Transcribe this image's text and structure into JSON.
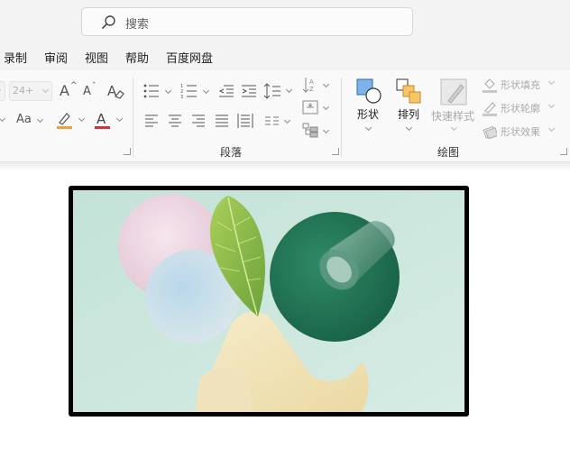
{
  "search": {
    "placeholder": "搜索"
  },
  "menu": {
    "items": [
      "录制",
      "审阅",
      "视图",
      "帮助",
      "百度网盘"
    ]
  },
  "font": {
    "size_value": "24+",
    "grow_glyph": "A",
    "shrink_glyph": "A",
    "case_label": "Aa"
  },
  "groups": {
    "paragraph": "段落",
    "drawing": "绘图"
  },
  "drawing": {
    "shapes_label": "形状",
    "arrange_label": "排列",
    "quick_styles_label": "快速样式",
    "shape_fill_label": "形状填充",
    "shape_outline_label": "形状轮廓",
    "shape_effects_label": "形状效果"
  },
  "colors": {
    "accent_blue": "#4a90d9",
    "highlight": "#e8a33c",
    "font_color": "#d13438"
  }
}
